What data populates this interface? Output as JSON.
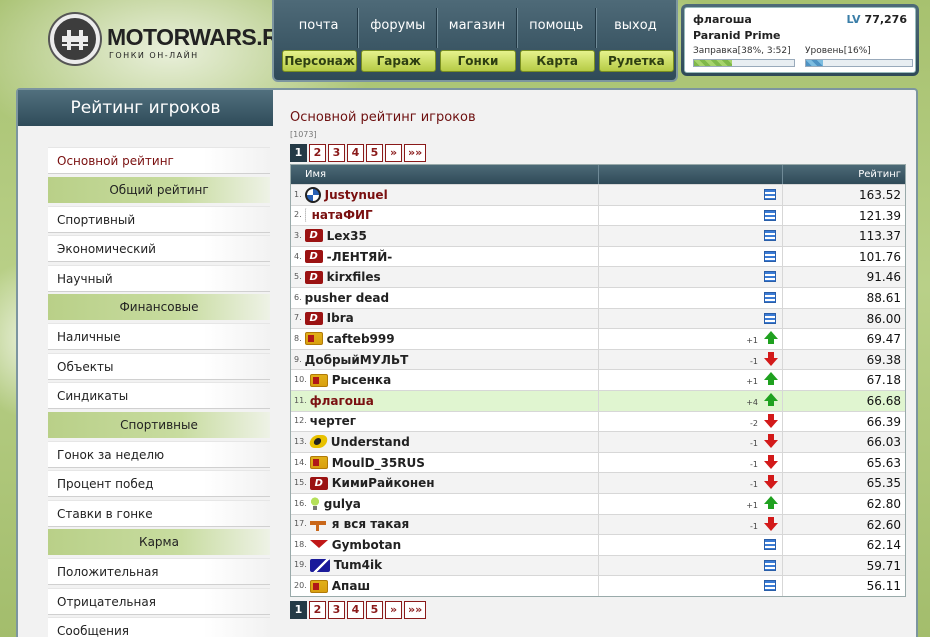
{
  "site": {
    "logo_title": "MOTORWARS.RU",
    "logo_sub": "ГОНКИ ОН-ЛАЙН"
  },
  "top_links": [
    "почта",
    "форумы",
    "магазин",
    "помощь",
    "выход"
  ],
  "top_buttons": [
    "Персонаж",
    "Гараж",
    "Гонки",
    "Карта",
    "Рулетка"
  ],
  "user": {
    "name": "флагоша",
    "lv_label": "LV",
    "lv_value": "77,276",
    "car": "Paranid Prime",
    "fuel_label": "Заправка[38%, 3:52]",
    "fuel_percent": 38,
    "level_label": "Уровень[16%]",
    "level_percent": 16
  },
  "sidebar": {
    "header": "Рейтинг игроков",
    "items": [
      {
        "type": "item",
        "label": "Основной рейтинг",
        "active": true
      },
      {
        "type": "head",
        "label": "Общий рейтинг"
      },
      {
        "type": "item",
        "label": "Спортивный"
      },
      {
        "type": "item",
        "label": "Экономический"
      },
      {
        "type": "item",
        "label": "Научный"
      },
      {
        "type": "head",
        "label": "Финансовые"
      },
      {
        "type": "item",
        "label": "Наличные"
      },
      {
        "type": "item",
        "label": "Объекты"
      },
      {
        "type": "item",
        "label": "Синдикаты"
      },
      {
        "type": "head",
        "label": "Спортивные"
      },
      {
        "type": "item",
        "label": "Гонок за неделю"
      },
      {
        "type": "item",
        "label": "Процент побед"
      },
      {
        "type": "item",
        "label": "Ставки в гонке"
      },
      {
        "type": "head",
        "label": "Карма"
      },
      {
        "type": "item",
        "label": "Положительная"
      },
      {
        "type": "item",
        "label": "Отрицательная"
      },
      {
        "type": "item",
        "label": "Сообщения"
      }
    ]
  },
  "content": {
    "title": "Основной рейтинг игроков",
    "count": "[1073]",
    "pager": [
      "1",
      "2",
      "3",
      "4",
      "5",
      "»",
      "»»"
    ],
    "pager_active": 0,
    "columns": {
      "name": "Имя",
      "rating": "Рейтинг"
    },
    "rows": [
      {
        "rank": "1.",
        "icon": "bmw-icon",
        "name": "Justynuel",
        "red": true,
        "change": "",
        "dir": "",
        "rating": "163.52"
      },
      {
        "rank": "2.",
        "icon": "dots-icon",
        "name": "натаФИГ",
        "red": true,
        "change": "",
        "dir": "",
        "rating": "121.39"
      },
      {
        "rank": "3.",
        "icon": "d-badge-icon",
        "name": "Lex35",
        "red": false,
        "change": "",
        "dir": "",
        "rating": "113.37"
      },
      {
        "rank": "4.",
        "icon": "d-badge-icon",
        "name": "-ЛЕНТЯЙ-",
        "red": false,
        "change": "",
        "dir": "",
        "rating": "101.76"
      },
      {
        "rank": "5.",
        "icon": "d-badge-icon",
        "name": "kirxfiles",
        "red": false,
        "change": "",
        "dir": "",
        "rating": "91.46"
      },
      {
        "rank": "6.",
        "icon": "",
        "name": "pusher dead",
        "red": false,
        "change": "",
        "dir": "",
        "rating": "88.61"
      },
      {
        "rank": "7.",
        "icon": "d-badge-icon",
        "name": "Ibra",
        "red": false,
        "change": "",
        "dir": "",
        "rating": "86.00"
      },
      {
        "rank": "8.",
        "icon": "flag-icon",
        "name": "cafteb999",
        "red": false,
        "change": "+1",
        "dir": "up",
        "rating": "69.47"
      },
      {
        "rank": "9.",
        "icon": "",
        "name": "ДобрыйМУЛЬТ",
        "red": false,
        "change": "-1",
        "dir": "down",
        "rating": "69.38"
      },
      {
        "rank": "10.",
        "icon": "flag-icon",
        "name": "Рысенка",
        "red": false,
        "change": "+1",
        "dir": "up",
        "rating": "67.18"
      },
      {
        "rank": "11.",
        "icon": "",
        "name": "флагоша",
        "red": true,
        "me": true,
        "change": "+4",
        "dir": "up",
        "rating": "66.68"
      },
      {
        "rank": "12.",
        "icon": "",
        "name": "чертег",
        "red": false,
        "change": "-2",
        "dir": "down",
        "rating": "66.39"
      },
      {
        "rank": "13.",
        "icon": "understand-icon",
        "name": "Understand",
        "red": false,
        "change": "-1",
        "dir": "down",
        "rating": "66.03"
      },
      {
        "rank": "14.",
        "icon": "flag-icon",
        "name": "MoulD_35RUS",
        "red": false,
        "change": "-1",
        "dir": "down",
        "rating": "65.63"
      },
      {
        "rank": "15.",
        "icon": "d-badge-icon",
        "name": "КимиРайконен",
        "red": false,
        "change": "-1",
        "dir": "down",
        "rating": "65.35"
      },
      {
        "rank": "16.",
        "icon": "bulb-icon",
        "name": "gulya",
        "red": false,
        "change": "+1",
        "dir": "up",
        "rating": "62.80"
      },
      {
        "rank": "17.",
        "icon": "dog-icon",
        "name": "я вся такая",
        "red": false,
        "change": "-1",
        "dir": "down",
        "rating": "62.60"
      },
      {
        "rank": "18.",
        "icon": "bird-icon",
        "name": "Gymbotan",
        "red": false,
        "change": "",
        "dir": "",
        "rating": "62.14"
      },
      {
        "rank": "19.",
        "icon": "triangle-flag-icon",
        "name": "Tum4ik",
        "red": false,
        "change": "",
        "dir": "",
        "rating": "59.71"
      },
      {
        "rank": "20.",
        "icon": "flag-icon",
        "name": "Апаш",
        "red": false,
        "change": "",
        "dir": "",
        "rating": "56.11"
      }
    ]
  }
}
